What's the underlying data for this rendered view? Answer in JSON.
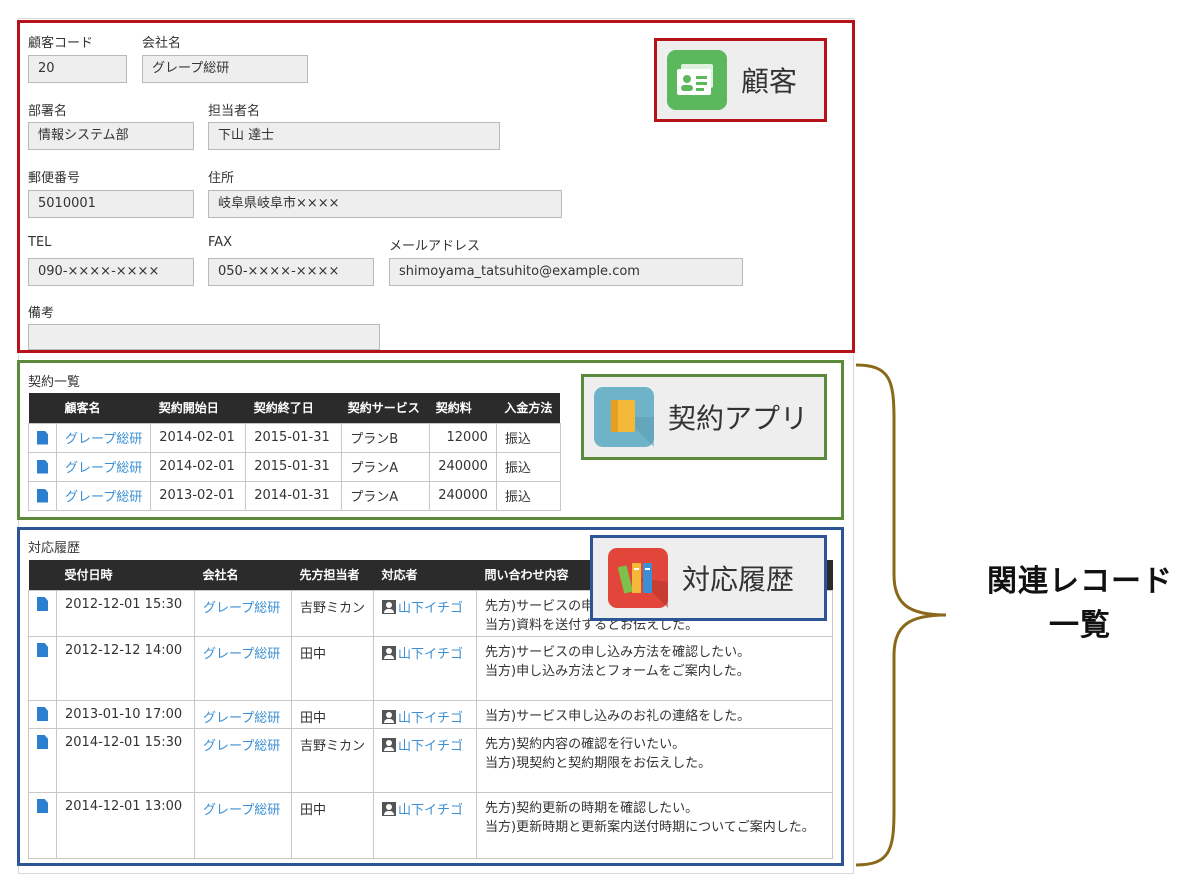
{
  "customer": {
    "fields": {
      "code": {
        "label": "顧客コード",
        "value": "20"
      },
      "company": {
        "label": "会社名",
        "value": "グレープ総研"
      },
      "department": {
        "label": "部署名",
        "value": "情報システム部"
      },
      "person": {
        "label": "担当者名",
        "value": "下山 達士"
      },
      "zip": {
        "label": "郵便番号",
        "value": "5010001"
      },
      "address": {
        "label": "住所",
        "value": "岐阜県岐阜市××××"
      },
      "tel": {
        "label": "TEL",
        "value": "090-××××-××××"
      },
      "fax": {
        "label": "FAX",
        "value": "050-××××-××××"
      },
      "email": {
        "label": "メールアドレス",
        "value": "shimoyama_tatsuhito@example.com"
      },
      "notes": {
        "label": "備考",
        "value": ""
      }
    },
    "callout": {
      "title": "顧客",
      "icon": "customer-card-icon",
      "color": "#5cb85c"
    }
  },
  "contracts": {
    "title": "契約一覧",
    "headers": [
      "顧客名",
      "契約開始日",
      "契約終了日",
      "契約サービス",
      "契約料",
      "入金方法"
    ],
    "rows": [
      {
        "customer": "グレープ総研",
        "start": "2014-02-01",
        "end": "2015-01-31",
        "service": "プランB",
        "fee": "12000",
        "payment": "振込"
      },
      {
        "customer": "グレープ総研",
        "start": "2014-02-01",
        "end": "2015-01-31",
        "service": "プランA",
        "fee": "240000",
        "payment": "振込"
      },
      {
        "customer": "グレープ総研",
        "start": "2013-02-01",
        "end": "2014-01-31",
        "service": "プランA",
        "fee": "240000",
        "payment": "振込"
      }
    ],
    "callout": {
      "title": "契約アプリ",
      "icon": "folder-icon",
      "color": "#6fb3c9"
    }
  },
  "history": {
    "title": "対応履歴",
    "headers": [
      "受付日時",
      "会社名",
      "先方担当者",
      "対応者",
      "問い合わせ内容"
    ],
    "rows": [
      {
        "datetime": "2012-12-01 15:30",
        "company": "グレープ総研",
        "contact": "吉野ミカン",
        "handler": "山下イチゴ",
        "content": "先方)サービスの申\n当方)資料を送付するとお伝えした。"
      },
      {
        "datetime": "2012-12-12 14:00",
        "company": "グレープ総研",
        "contact": "田中",
        "handler": "山下イチゴ",
        "content": "先方)サービスの申し込み方法を確認したい。\n当方)申し込み方法とフォームをご案内した。"
      },
      {
        "datetime": "2013-01-10 17:00",
        "company": "グレープ総研",
        "contact": "田中",
        "handler": "山下イチゴ",
        "content": "当方)サービス申し込みのお礼の連絡をした。"
      },
      {
        "datetime": "2014-12-01 15:30",
        "company": "グレープ総研",
        "contact": "吉野ミカン",
        "handler": "山下イチゴ",
        "content": "先方)契約内容の確認を行いたい。\n当方)現契約と契約期限をお伝えした。"
      },
      {
        "datetime": "2014-12-01 13:00",
        "company": "グレープ総研",
        "contact": "田中",
        "handler": "山下イチゴ",
        "content": "先方)契約更新の時期を確認したい。\n当方)更新時期と更新案内送付時期についてご案内した。"
      }
    ],
    "callout": {
      "title": "対応履歴",
      "icon": "binders-icon",
      "color": "#e2463a"
    }
  },
  "annotation": {
    "line1": "関連レコード",
    "line2": "一覧",
    "brace_color": "#8a6a1a"
  }
}
